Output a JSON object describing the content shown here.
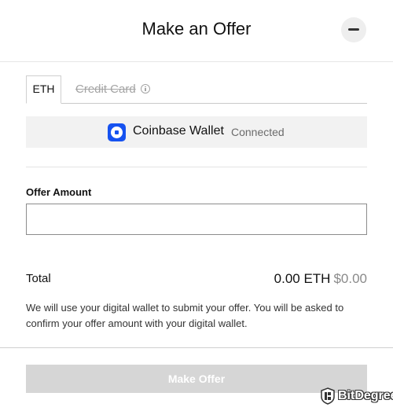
{
  "header": {
    "title": "Make an Offer",
    "close_icon": "minus-icon"
  },
  "tabs": {
    "active": "ETH",
    "disabled": "Credit Card",
    "info_icon": "info-circle-icon"
  },
  "wallet": {
    "name": "Coinbase Wallet",
    "status": "Connected",
    "icon": "coinbase-wallet-icon",
    "brand_color": "#1652f0"
  },
  "offer": {
    "label": "Offer Amount",
    "value": "",
    "placeholder": ""
  },
  "total": {
    "label": "Total",
    "eth": "0.00 ETH",
    "usd": "$0.00"
  },
  "note": "We will use your digital wallet to submit your offer. You will be asked to confirm your offer amount with your digital wallet.",
  "submit": {
    "label": "Make Offer",
    "color": "#d6d6d6"
  },
  "watermark": {
    "text": "BitDegree",
    "icon": "bitdegree-shield-icon"
  }
}
